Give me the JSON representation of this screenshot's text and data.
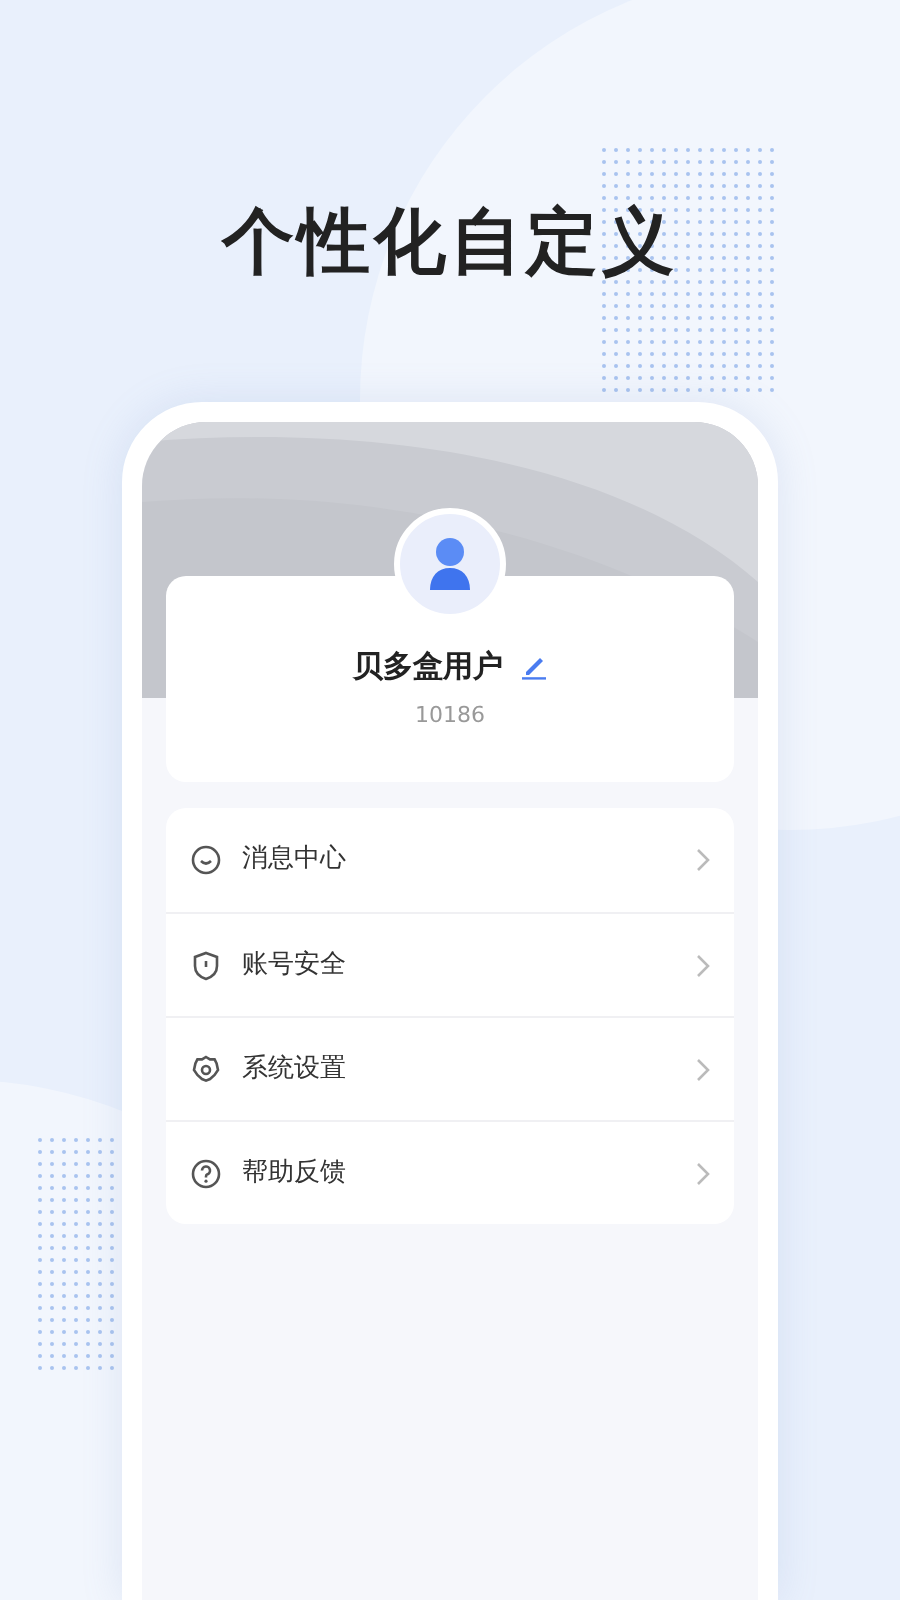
{
  "headline": "个性化自定义",
  "profile": {
    "name": "贝多盒用户",
    "id": "10186"
  },
  "menu": [
    {
      "kind": "message",
      "label": "消息中心"
    },
    {
      "kind": "shield",
      "label": "账号安全"
    },
    {
      "kind": "gear",
      "label": "系统设置"
    },
    {
      "kind": "help",
      "label": "帮助反馈"
    }
  ]
}
